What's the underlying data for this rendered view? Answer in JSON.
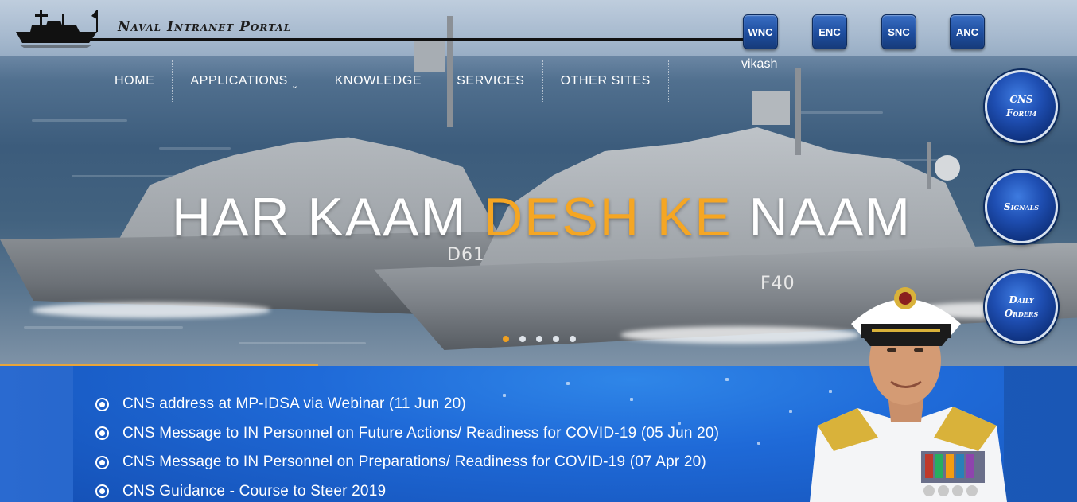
{
  "header": {
    "portal_title": "Naval Intranet Portal",
    "username": "vikash"
  },
  "top_buttons": [
    {
      "label": "WNC"
    },
    {
      "label": "ENC"
    },
    {
      "label": "SNC"
    },
    {
      "label": "ANC"
    }
  ],
  "nav": {
    "items": [
      {
        "label": "HOME"
      },
      {
        "label": "APPLICATIONS"
      },
      {
        "label": "KNOWLEDGE"
      },
      {
        "label": "SERVICES"
      },
      {
        "label": "OTHER SITES"
      }
    ]
  },
  "side_buttons": [
    {
      "label": "CNS Forum"
    },
    {
      "label": "Signals"
    },
    {
      "label": "Daily Orders"
    }
  ],
  "hero": {
    "slogan_part1": "HAR KAAM ",
    "slogan_part2": "DESH KE",
    "slogan_part3": " NAAM",
    "hull_number_1": "D61",
    "hull_number_2": "F40",
    "slides_total": 5,
    "active_slide": 1
  },
  "news": [
    {
      "text": "CNS address at MP-IDSA via Webinar (11 Jun 20)"
    },
    {
      "text": "CNS Message to IN Personnel on Future Actions/ Readiness for COVID-19 (05 Jun 20)"
    },
    {
      "text": "CNS Message to IN Personnel on Preparations/ Readiness for COVID-19 (07 Apr 20)"
    },
    {
      "text": "CNS Guidance - Course to Steer 2019"
    }
  ],
  "colors": {
    "accent_orange": "#f5a623",
    "button_blue": "#1e4d9e",
    "panel_blue": "#1f6ad8"
  }
}
